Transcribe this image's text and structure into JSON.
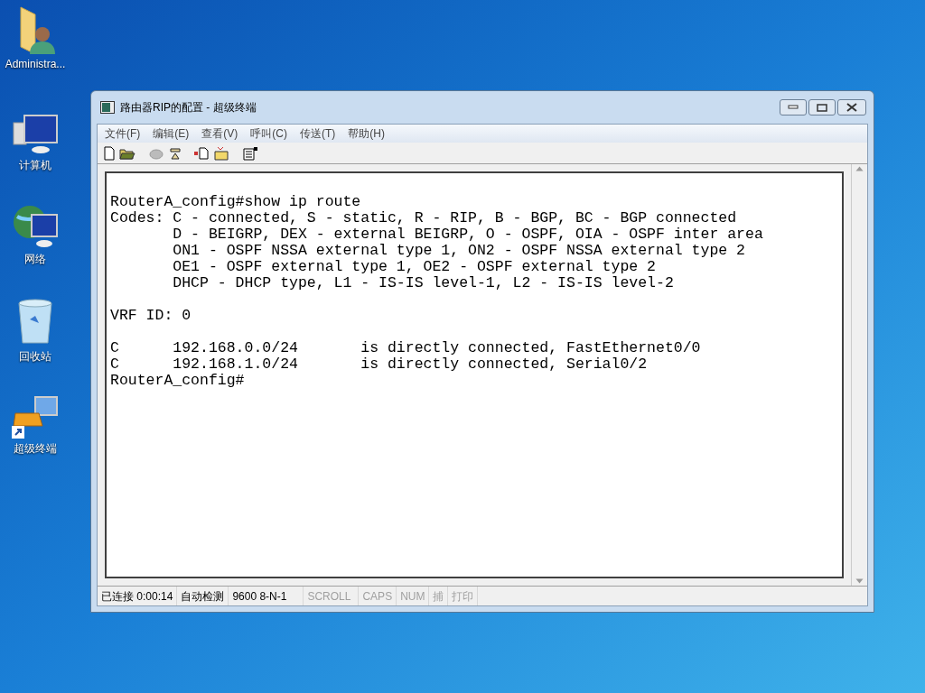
{
  "desktop_icons": [
    {
      "label": "Administra...",
      "kind": "user-folder"
    },
    {
      "label": "计算机",
      "kind": "computer"
    },
    {
      "label": "网络",
      "kind": "network"
    },
    {
      "label": "回收站",
      "kind": "recycle-bin"
    },
    {
      "label": "超级终端",
      "kind": "terminal-shortcut"
    }
  ],
  "window": {
    "title": "路由器RIP的配置 - 超级终端"
  },
  "menu": [
    "文件(F)",
    "编辑(E)",
    "查看(V)",
    "呼叫(C)",
    "传送(T)",
    "帮助(H)"
  ],
  "terminal": {
    "blocks": [
      [
        "RouterA_config#show ip route",
        "Codes: C - connected, S - static, R - RIP, B - BGP, BC - BGP connected",
        "       D - BEIGRP, DEX - external BEIGRP, O - OSPF, OIA - OSPF inter area",
        "       ON1 - OSPF NSSA external type 1, ON2 - OSPF NSSA external type 2",
        "       OE1 - OSPF external type 1, OE2 - OSPF external type 2",
        "       DHCP - DHCP type, L1 - IS-IS level-1, L2 - IS-IS level-2"
      ],
      [
        "VRF ID: 0"
      ],
      [
        "C      192.168.0.0/24       is directly connected, FastEthernet0/0",
        "C      192.168.1.0/24       is directly connected, Serial0/2",
        "RouterA_config#"
      ]
    ]
  },
  "status_bar": [
    {
      "text": "已连接 0:00:14",
      "disabled": false
    },
    {
      "text": "自动检测",
      "disabled": false
    },
    {
      "text": "9600 8-N-1",
      "disabled": false
    },
    {
      "text": "SCROLL",
      "disabled": true
    },
    {
      "text": "CAPS",
      "disabled": true
    },
    {
      "text": "NUM",
      "disabled": true
    },
    {
      "text": "捕",
      "disabled": true
    },
    {
      "text": "打印",
      "disabled": true
    }
  ]
}
